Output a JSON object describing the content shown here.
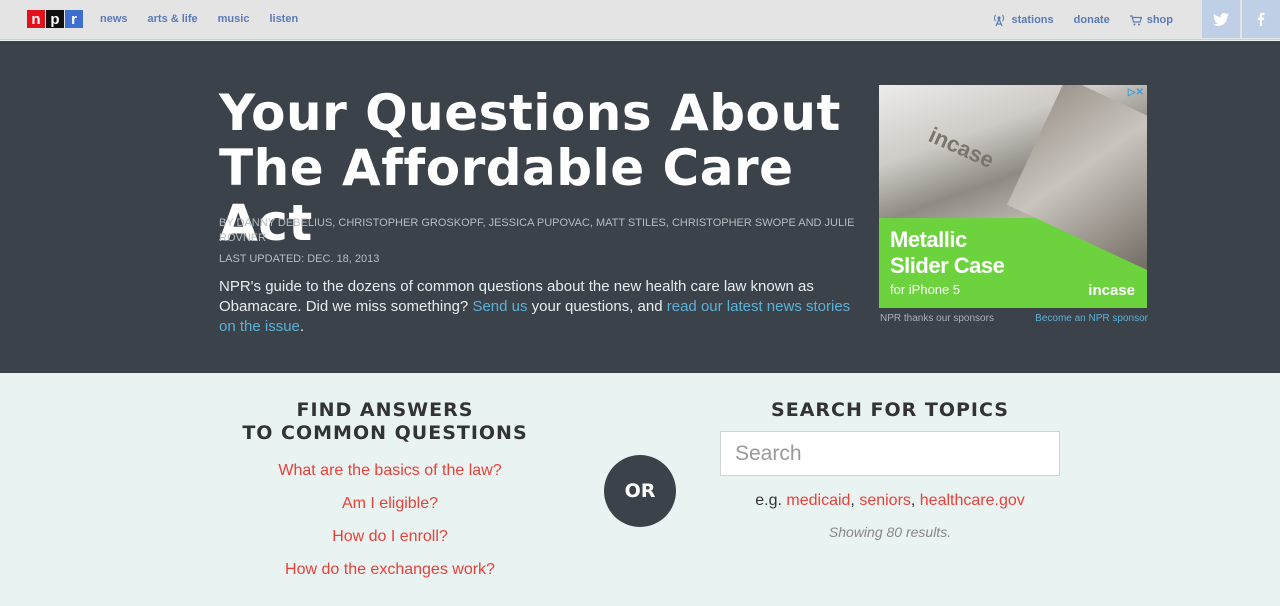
{
  "nav": {
    "logo": [
      "n",
      "p",
      "r"
    ],
    "left_links": [
      "news",
      "arts & life",
      "music",
      "listen"
    ],
    "stations_label": "stations",
    "donate_label": "donate",
    "shop_label": "shop",
    "twitter_icon": "twitter-icon",
    "facebook_icon": "facebook-icon"
  },
  "hero": {
    "title_line1": "Your Questions About",
    "title_line2": "The Affordable Care Act",
    "byline": "By Danny Debelius, Christopher Groskopf, Jessica Pupovac, Matt Stiles, Christopher Swope and Julie Rovner",
    "updated": "Last updated: Dec. 18, 2013",
    "intro_prefix": "NPR's guide to the dozens of common questions about the new health care law known as Obamacare. Did we miss something? ",
    "intro_link1": "Send us",
    "intro_middle": " your questions, and ",
    "intro_link2": "read our latest news stories on the issue",
    "intro_suffix": "."
  },
  "ad": {
    "brand": "incase",
    "headline_line1": "Metallic",
    "headline_line2": "Slider Case",
    "sub": "for iPhone 5",
    "logo": "incase",
    "thanks": "NPR thanks our sponsors",
    "become": "Become an NPR sponsor"
  },
  "find": {
    "title_line1": "FIND ANSWERS",
    "title_line2": "TO COMMON QUESTIONS",
    "questions": [
      "What are the basics of the law?",
      "Am I eligible?",
      "How do I enroll?",
      "How do the exchanges work?"
    ]
  },
  "or_label": "OR",
  "search": {
    "title": "SEARCH FOR TOPICS",
    "placeholder": "Search",
    "examples_prefix": "e.g. ",
    "examples": [
      "medicaid",
      "seniors",
      "healthcare.gov"
    ],
    "results": "Showing 80 results."
  }
}
